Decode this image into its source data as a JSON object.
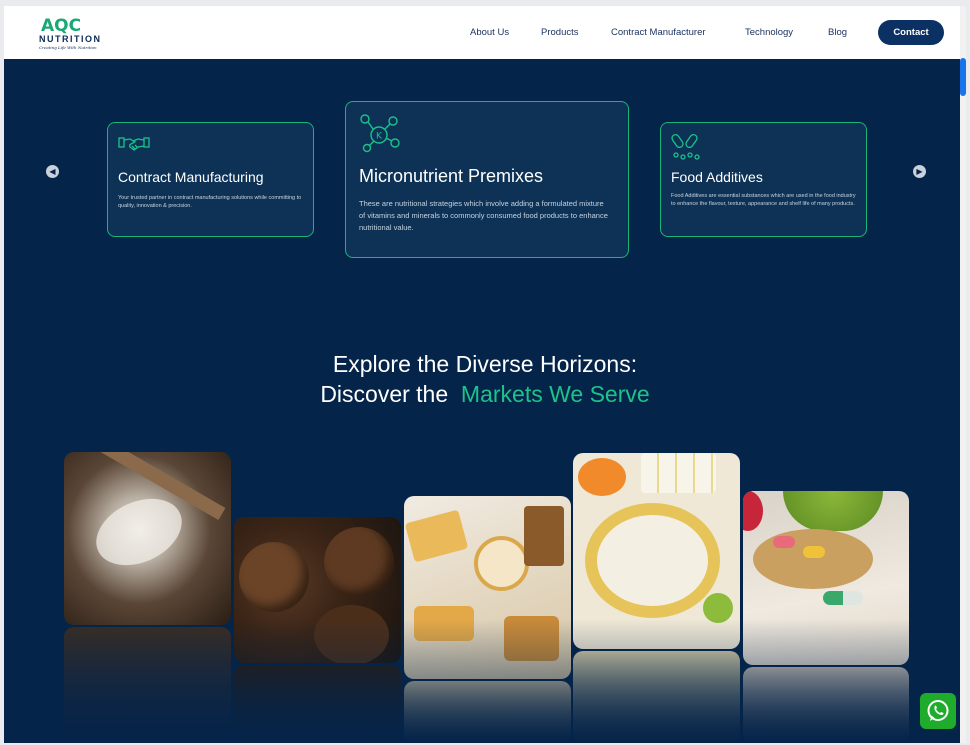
{
  "logo": {
    "mark": "AQC",
    "name": "NUTRITION",
    "tagline": "Creating Life With Nutrition"
  },
  "nav": {
    "items": [
      "About Us",
      "Products",
      "Contract Manufacturer",
      "Technology",
      "Blog"
    ],
    "contact_label": "Contact"
  },
  "cards": [
    {
      "title": "Contract Manufacturing",
      "desc": "Your trusted partner in contract manufacturing solutions while committing to quality, innovation & precision.",
      "icon": "handshake-icon"
    },
    {
      "title": "Micronutrient Premixes",
      "desc": "These are nutritional strategies which involve adding a formulated mixture of vitamins and minerals to commonly consumed food products to enhance nutritional value.",
      "icon": "molecule-icon"
    },
    {
      "title": "Food Additives",
      "desc": "Food Additives are essential substances which are used in the food industry to enhance the flavour, texture, appearance and shelf life of many products.",
      "icon": "capsules-icon"
    }
  ],
  "section": {
    "line1": "Explore the Diverse Horizons:",
    "line2_plain": "Discover the",
    "line2_accent": "Markets We Serve"
  },
  "colors": {
    "navy": "#052449",
    "accent": "#1bc28a",
    "card_border": "#19b47a",
    "whatsapp": "#1fab2b"
  }
}
